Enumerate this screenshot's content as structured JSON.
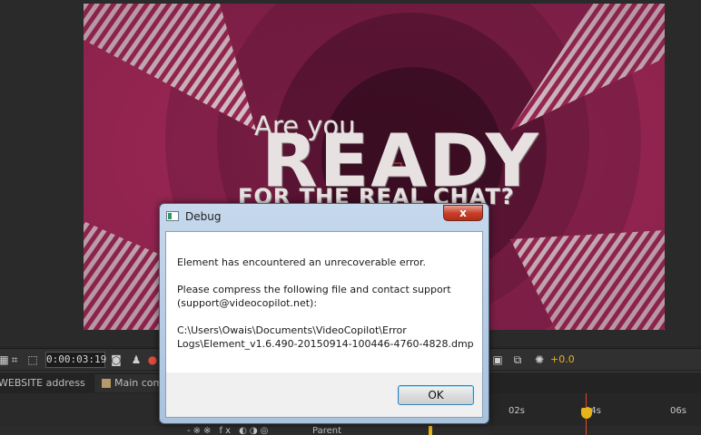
{
  "composition": {
    "line1": "Are you",
    "line2": "READY",
    "line3": "FOR THE REAL CHAT?",
    "bg_color": "#9b2451"
  },
  "viewer_toolbar": {
    "timecode": "0:00:03:19",
    "exposure": "+0.0",
    "icons": [
      "region-of-interest-icon",
      "transparency-grid-icon",
      "camera-snapshot-icon",
      "show-snapshot-icon",
      "color-channel-icon",
      "reset-exposure-icon",
      "flowchart-icon",
      "exposure-icon"
    ]
  },
  "tabs": [
    {
      "label": "WEBSITE address"
    },
    {
      "label": "Main comp"
    }
  ],
  "timeline": {
    "ruler_labels": [
      "02s",
      "04s",
      "06s"
    ],
    "parent_label": "Parent",
    "switch_glyphs": "-※※ fx ◐◑◎"
  },
  "dialog": {
    "title": "Debug",
    "close_label": "x",
    "message_line1": "Element has encountered an unrecoverable error.",
    "message_line2": "Please compress the following file and contact support",
    "message_line3": "(support@videocopilot.net):",
    "path_line1": "C:\\Users\\Owais\\Documents\\VideoCopilot\\Error",
    "path_line2": "Logs\\Element_v1.6.490-20150914-100446-4760-4828.dmp",
    "ok_label": "OK"
  }
}
